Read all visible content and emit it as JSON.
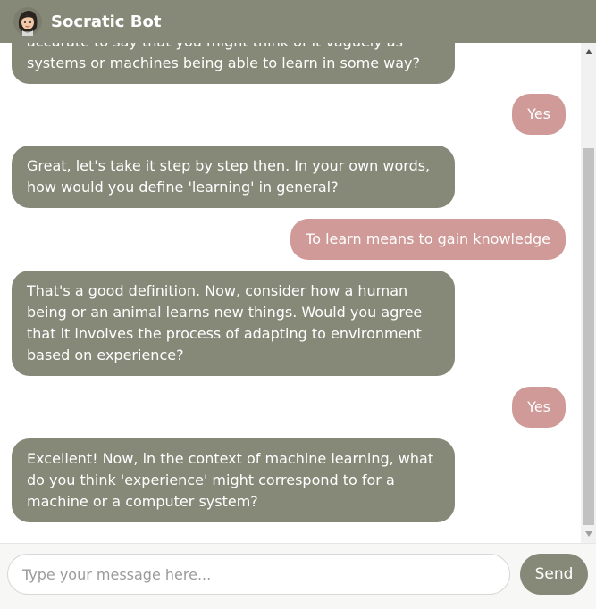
{
  "header": {
    "title": "Socratic Bot",
    "avatar_icon": "woman-avatar-icon"
  },
  "messages": [
    {
      "sender": "bot",
      "text": "accurate to say that you might think of it vaguely as systems or machines being able to learn in some way?"
    },
    {
      "sender": "user",
      "text": "Yes"
    },
    {
      "sender": "bot",
      "text": "Great, let's take it step by step then. In your own words, how would you define 'learning' in general?"
    },
    {
      "sender": "user",
      "text": "To learn means to gain knowledge"
    },
    {
      "sender": "bot",
      "text": "That's a good definition. Now, consider how a human being or an animal learns new things. Would you agree that it involves the process of adapting to environment based on experience?"
    },
    {
      "sender": "user",
      "text": "Yes"
    },
    {
      "sender": "bot",
      "text": "Excellent! Now, in the context of machine learning, what do you think 'experience' might correspond to for a machine or a computer system?"
    }
  ],
  "composer": {
    "placeholder": "Type your message here...",
    "value": "",
    "send_label": "Send"
  },
  "colors": {
    "header_bg": "#868878",
    "bot_bubble": "#868878",
    "user_bubble": "#cf9a98",
    "send_button": "#868878"
  }
}
